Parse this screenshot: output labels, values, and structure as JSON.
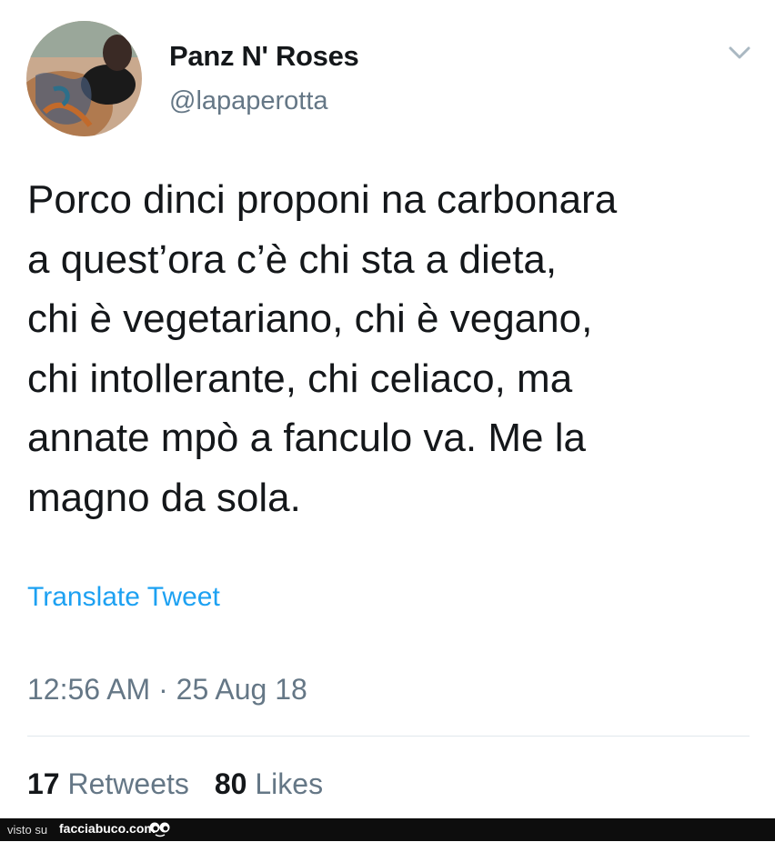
{
  "tweet": {
    "display_name": "Panz N' Roses",
    "handle": "@lapaperotta",
    "avatar_icon": "user-avatar",
    "caret_icon": "chevron-down-icon",
    "text_lines": [
      "Porco dinci proponi na carbonara",
      "a quest’ora c’è chi sta a dieta,",
      "chi è vegetariano, chi è vegano,",
      "chi intollerante, chi celiaco, ma",
      "annate mpò a fanculo va. Me la",
      "magno da sola."
    ],
    "translate_label": "Translate Tweet",
    "timestamp": "12:56 AM · 25 Aug 18",
    "retweets_count": "17",
    "retweets_label": "Retweets",
    "likes_count": "80",
    "likes_label": "Likes"
  },
  "footer": {
    "prefix": "visto su",
    "site": "facciabuco.com",
    "logo_icon": "eyes-icon"
  },
  "colors": {
    "accent": "#1da1f2",
    "secondary_text": "#657786",
    "primary_text": "#14171a",
    "divider": "#e1e8ed"
  }
}
